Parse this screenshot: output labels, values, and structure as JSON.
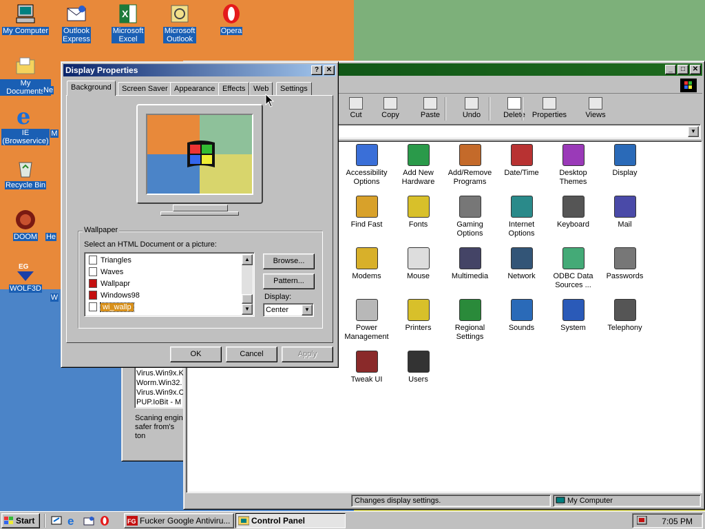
{
  "desktop": {
    "icons": [
      {
        "label": "My Computer"
      },
      {
        "label": "Outlook Express"
      },
      {
        "label": "Microsoft Excel"
      },
      {
        "label": "Microsoft Outlook"
      },
      {
        "label": "Opera"
      },
      {
        "label": "My Documents"
      },
      {
        "label": "IE (Browservice)"
      },
      {
        "label": "Recycle Bin"
      },
      {
        "label": "DOOM"
      },
      {
        "label": "WOLF3D"
      },
      {
        "label": "Ne"
      },
      {
        "label": "M"
      },
      {
        "label": "He"
      },
      {
        "label": "W"
      }
    ]
  },
  "control_panel": {
    "toolbar": [
      {
        "label": "Cut"
      },
      {
        "label": "Copy"
      },
      {
        "label": "Paste"
      },
      {
        "label": "Undo"
      },
      {
        "label": "Delete"
      },
      {
        "label": "Properties"
      },
      {
        "label": "Views"
      }
    ],
    "items": [
      "Accessibility Options",
      "Add New Hardware",
      "Add/Remove Programs",
      "Date/Time",
      "Desktop Themes",
      "Display",
      "Find Fast",
      "Fonts",
      "Gaming Options",
      "Internet Options",
      "Keyboard",
      "Mail",
      "Modems",
      "Mouse",
      "Multimedia",
      "Network",
      "ODBC Data Sources ...",
      "Passwords",
      "Power Management",
      "Printers",
      "Regional Settings",
      "Sounds",
      "System",
      "Telephony",
      "Tweak UI",
      "Users"
    ],
    "status_left": "Changes display settings.",
    "status_right": "My Computer"
  },
  "bg_window": {
    "lines": [
      "Virus.Win9x.K",
      "Worm.Win32.",
      "Virus.Win9x.C",
      "PUP.IoBit - M"
    ],
    "text": "Scaning engin safer from's ton"
  },
  "dialog": {
    "title": "Display Properties",
    "tabs": [
      "Background",
      "Screen Saver",
      "Appearance",
      "Effects",
      "Web",
      "Settings"
    ],
    "wallpaper_group": "Wallpaper",
    "select_label": "Select an HTML Document or a picture:",
    "list": [
      "Triangles",
      "Waves",
      "Wallpapr",
      "Windows98",
      "wi_wallp"
    ],
    "browse": "Browse...",
    "pattern": "Pattern...",
    "display_label": "Display:",
    "display_value": "Center",
    "ok": "OK",
    "cancel": "Cancel",
    "apply": "Apply"
  },
  "taskbar": {
    "start": "Start",
    "tasks": [
      "Fucker Google Antiviru...",
      "Control Panel"
    ],
    "clock": "7:05 PM"
  }
}
